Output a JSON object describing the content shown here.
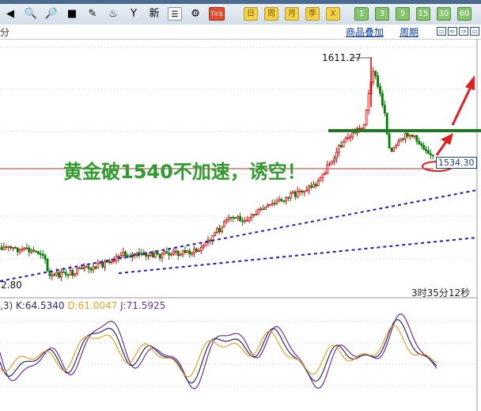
{
  "toolbar": {
    "tools": [
      {
        "name": "back-icon",
        "glyph": "◀"
      },
      {
        "name": "zoom-in-icon",
        "glyph": "🔍"
      },
      {
        "name": "zoom-out-icon",
        "glyph": "🔎"
      },
      {
        "name": "window-icon",
        "glyph": "■"
      },
      {
        "name": "draw-line-icon",
        "glyph": "✎"
      },
      {
        "name": "formula-icon",
        "glyph": "♨"
      },
      {
        "name": "filter-icon",
        "glyph": "Y"
      },
      {
        "name": "new-icon",
        "glyph": "新"
      },
      {
        "name": "table-icon",
        "glyph": "☰"
      },
      {
        "name": "indicator-icon",
        "glyph": "⚙"
      },
      {
        "name": "tick-icon",
        "glyph": "Tick"
      }
    ],
    "periods": [
      "日",
      "周",
      "月",
      "季"
    ],
    "close_glyph": "X",
    "minutes": [
      "1",
      "3",
      "5",
      "15",
      "30",
      "60"
    ]
  },
  "subbar": {
    "left_tail": "分",
    "overlay_link": "商品叠加",
    "period_link": "周期"
  },
  "price_panel": {
    "peak_label": "1611.27",
    "low_label": "2.80",
    "current_price": "1534.30",
    "annotation": "黄金破1540不加速，诱空！",
    "countdown": "3时35分12秒"
  },
  "indicator": {
    "params": ",3)",
    "k": "K:64.5340",
    "d": "D:61.0047",
    "j": "J:71.5925"
  },
  "colors": {
    "up": "#e00000",
    "down": "#008000",
    "annotation": "#2e9c2e",
    "support": "#1a1ad0",
    "resistance": "#1f7a1f",
    "k_line": "#2a2a70",
    "d_line": "#e8a020",
    "j_line": "#6a30a0"
  }
}
